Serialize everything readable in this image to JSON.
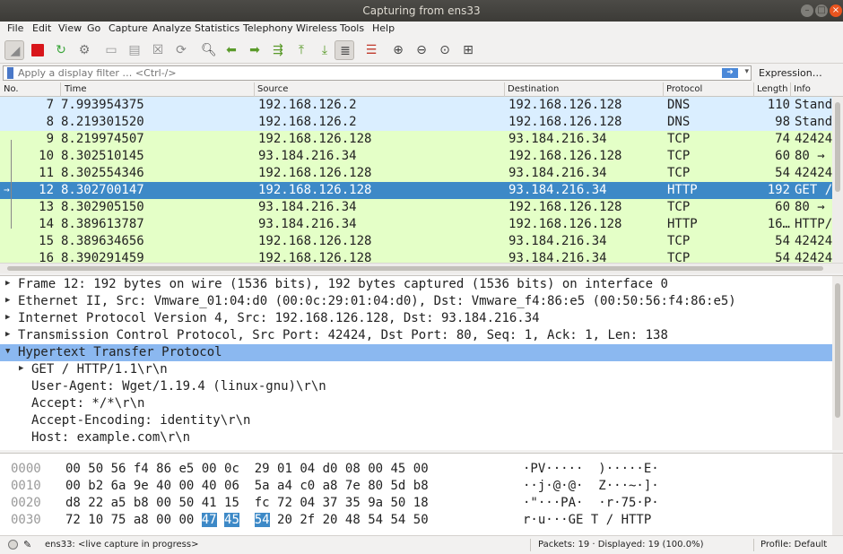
{
  "window": {
    "title": "Capturing from ens33"
  },
  "menu": [
    "File",
    "Edit",
    "View",
    "Go",
    "Capture",
    "Analyze",
    "Statistics",
    "Telephony",
    "Wireless",
    "Tools",
    "Help"
  ],
  "toolbar": {
    "icons": [
      "shark-fin-start-icon",
      "stop-capture-icon",
      "restart-capture-icon",
      "capture-options-icon",
      "open-file-icon",
      "save-file-icon",
      "close-file-icon",
      "reload-file-icon",
      "find-packet-icon",
      "go-back-icon",
      "go-forward-icon",
      "go-to-packet-icon",
      "first-packet-icon",
      "last-packet-icon",
      "autoscroll-icon",
      "colorize-icon",
      "zoom-in-icon",
      "zoom-out-icon",
      "normal-size-icon",
      "resize-columns-icon"
    ]
  },
  "filter": {
    "placeholder": "Apply a display filter … <Ctrl-/>",
    "value": "",
    "expression_label": "Expression…"
  },
  "packet_list": {
    "columns": [
      "No.",
      "Time",
      "Source",
      "Destination",
      "Protocol",
      "Length",
      "Info"
    ],
    "rows": [
      {
        "no": "7",
        "time": "7.993954375",
        "src": "192.168.126.2",
        "dst": "192.168.126.128",
        "proto": "DNS",
        "len": "110",
        "info": "Stand",
        "kind": "dns"
      },
      {
        "no": "8",
        "time": "8.219301520",
        "src": "192.168.126.2",
        "dst": "192.168.126.128",
        "proto": "DNS",
        "len": "98",
        "info": "Stand",
        "kind": "dns"
      },
      {
        "no": "9",
        "time": "8.219974507",
        "src": "192.168.126.128",
        "dst": "93.184.216.34",
        "proto": "TCP",
        "len": "74",
        "info": "42424",
        "kind": "tcp"
      },
      {
        "no": "10",
        "time": "8.302510145",
        "src": "93.184.216.34",
        "dst": "192.168.126.128",
        "proto": "TCP",
        "len": "60",
        "info": "80 →",
        "kind": "tcp"
      },
      {
        "no": "11",
        "time": "8.302554346",
        "src": "192.168.126.128",
        "dst": "93.184.216.34",
        "proto": "TCP",
        "len": "54",
        "info": "42424",
        "kind": "tcp"
      },
      {
        "no": "12",
        "time": "8.302700147",
        "src": "192.168.126.128",
        "dst": "93.184.216.34",
        "proto": "HTTP",
        "len": "192",
        "info": "GET /",
        "kind": "sel"
      },
      {
        "no": "13",
        "time": "8.302905150",
        "src": "93.184.216.34",
        "dst": "192.168.126.128",
        "proto": "TCP",
        "len": "60",
        "info": "80 →",
        "kind": "tcp"
      },
      {
        "no": "14",
        "time": "8.389613787",
        "src": "93.184.216.34",
        "dst": "192.168.126.128",
        "proto": "HTTP",
        "len": "16…",
        "info": "HTTP/",
        "kind": "http"
      },
      {
        "no": "15",
        "time": "8.389634656",
        "src": "192.168.126.128",
        "dst": "93.184.216.34",
        "proto": "TCP",
        "len": "54",
        "info": "42424",
        "kind": "tcp"
      },
      {
        "no": "16",
        "time": "8.390291459",
        "src": "192.168.126.128",
        "dst": "93.184.216.34",
        "proto": "TCP",
        "len": "54",
        "info": "42424",
        "kind": "tcp"
      }
    ]
  },
  "details": [
    {
      "text": "Frame 12: 192 bytes on wire (1536 bits), 192 bytes captured (1536 bits) on interface 0",
      "expander": "collapsed",
      "indent": 0
    },
    {
      "text": "Ethernet II, Src: Vmware_01:04:d0 (00:0c:29:01:04:d0), Dst: Vmware_f4:86:e5 (00:50:56:f4:86:e5)",
      "expander": "collapsed",
      "indent": 0
    },
    {
      "text": "Internet Protocol Version 4, Src: 192.168.126.128, Dst: 93.184.216.34",
      "expander": "collapsed",
      "indent": 0
    },
    {
      "text": "Transmission Control Protocol, Src Port: 42424, Dst Port: 80, Seq: 1, Ack: 1, Len: 138",
      "expander": "collapsed",
      "indent": 0
    },
    {
      "text": "Hypertext Transfer Protocol",
      "expander": "expanded",
      "indent": 0,
      "selected": true
    },
    {
      "text": "GET / HTTP/1.1\\r\\n",
      "expander": "collapsed",
      "indent": 1
    },
    {
      "text": "User-Agent: Wget/1.19.4 (linux-gnu)\\r\\n",
      "expander": "none",
      "indent": 1
    },
    {
      "text": "Accept: */*\\r\\n",
      "expander": "none",
      "indent": 1
    },
    {
      "text": "Accept-Encoding: identity\\r\\n",
      "expander": "none",
      "indent": 1
    },
    {
      "text": "Host: example.com\\r\\n",
      "expander": "none",
      "indent": 1
    }
  ],
  "hex_dump": [
    {
      "offset": "0000",
      "bytes": [
        "00",
        "50",
        "56",
        "f4",
        "86",
        "e5",
        "00",
        "0c",
        "29",
        "01",
        "04",
        "d0",
        "08",
        "00",
        "45",
        "00"
      ],
      "ascii": "·PV·····  )·····E·"
    },
    {
      "offset": "0010",
      "bytes": [
        "00",
        "b2",
        "6a",
        "9e",
        "40",
        "00",
        "40",
        "06",
        "5a",
        "a4",
        "c0",
        "a8",
        "7e",
        "80",
        "5d",
        "b8"
      ],
      "ascii": "··j·@·@·  Z···~·]·"
    },
    {
      "offset": "0020",
      "bytes": [
        "d8",
        "22",
        "a5",
        "b8",
        "00",
        "50",
        "41",
        "15",
        "fc",
        "72",
        "04",
        "37",
        "35",
        "9a",
        "50",
        "18"
      ],
      "ascii": "·\"···PA·  ·r·75·P·"
    },
    {
      "offset": "0030",
      "bytes": [
        "72",
        "10",
        "75",
        "a8",
        "00",
        "00",
        "47",
        "45",
        "54",
        "20",
        "2f",
        "20",
        "48",
        "54",
        "54",
        "50"
      ],
      "ascii": "r·u···GE T / HTTP",
      "hl_from": 6,
      "hl_to": 8
    }
  ],
  "status": {
    "interface": "ens33: <live capture in progress>",
    "packets": "Packets: 19 · Displayed: 19 (100.0%)",
    "profile": "Profile: Default"
  },
  "colors": {
    "dns_row": "#daeeff",
    "tcp_row": "#e4ffc7",
    "selected_row": "#3d89c7",
    "selected_detail": "#8bb8f0"
  }
}
